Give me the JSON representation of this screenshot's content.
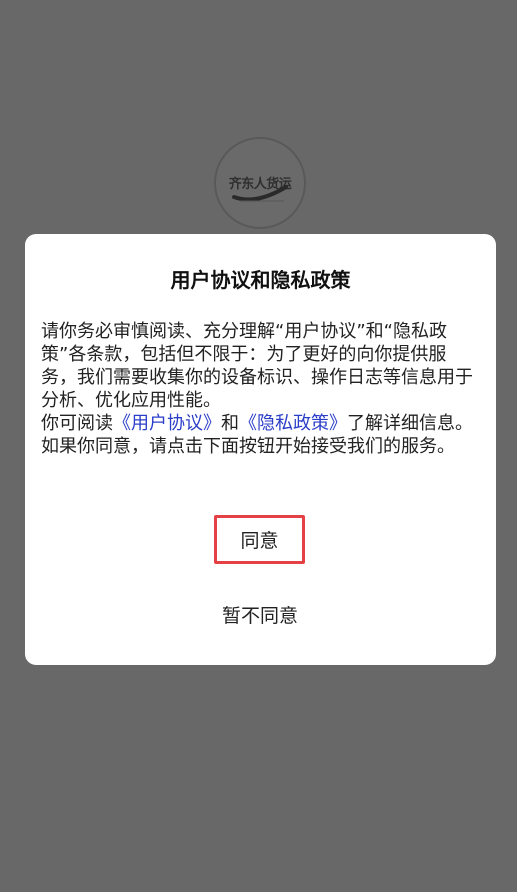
{
  "logo": {
    "text": "齐东人货运",
    "icon": "truck-logo-icon"
  },
  "dialog": {
    "title": "用户协议和隐私政策",
    "paragraph1": "请你务必审慎阅读、充分理解“用户协议”和“隐私政策”各条款，包括但不限于：为了更好的向你提供服务，我们需要收集你的设备标识、操作日志等信息用于分析、优化应用性能。",
    "paragraph2_prefix": "你可阅读",
    "user_agreement_link": "《用户协议》",
    "conjunction": "和",
    "privacy_policy_link": "《隐私政策》",
    "paragraph2_suffix": "了解详细信息。如果你同意，请点击下面按钮开始接受我们的服务。",
    "agree_label": "同意",
    "disagree_label": "暂不同意"
  },
  "colors": {
    "backdrop": "#686868",
    "dialog_bg": "#ffffff",
    "link": "#2b3ec8",
    "highlight_border": "#e44046"
  }
}
